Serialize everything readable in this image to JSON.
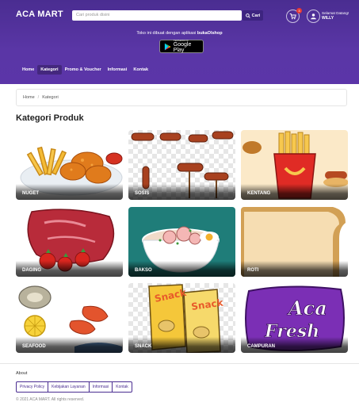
{
  "header": {
    "brand": "ACA MART",
    "search_placeholder": "Cari produk disini",
    "search_button": "Cari",
    "cart_count": "3",
    "greeting": "Selamat Datang!",
    "username": "WILLY",
    "promo_text": "Toko ini dibuat dengan aplikasi",
    "promo_app": "bukaOlshop",
    "gplay_small": "TERSEDIA DI",
    "gplay_big": "Google Play"
  },
  "nav": {
    "items": [
      {
        "label": "Home"
      },
      {
        "label": "Kategori"
      },
      {
        "label": "Promo & Voucher"
      },
      {
        "label": "Informasi"
      },
      {
        "label": "Kontak"
      }
    ]
  },
  "breadcrumb": {
    "home": "Home",
    "current": "Kategori"
  },
  "page_title": "Kategori Produk",
  "categories": [
    {
      "label": "NUGET"
    },
    {
      "label": "SOSIS"
    },
    {
      "label": "KENTANG"
    },
    {
      "label": "DAGING"
    },
    {
      "label": "BAKSO"
    },
    {
      "label": "ROTI"
    },
    {
      "label": "SEAFOOD"
    },
    {
      "label": "SNACK"
    },
    {
      "label": "CAMPURAN"
    }
  ],
  "footer": {
    "about": "About",
    "links": [
      "Privacy Policy",
      "Kebijakan Layanan",
      "Informasi",
      "Kontak"
    ],
    "copyright": "© 2021 ACA MART. All rights reserved."
  },
  "colors": {
    "header_purple": "#4a2d91",
    "badge_red": "#e53935"
  }
}
